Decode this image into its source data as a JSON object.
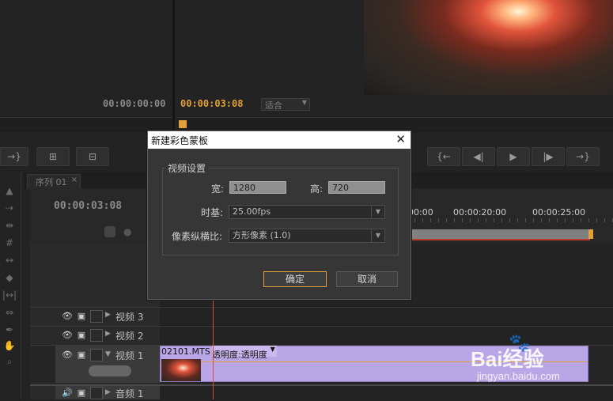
{
  "source_monitor": {
    "timecode": "00:00:00:00"
  },
  "program_monitor": {
    "timecode": "00:00:03:08",
    "zoom": "适合"
  },
  "sequence": {
    "tab": "序列 01",
    "timecode": "00:00:03:08",
    "ruler": [
      "00:00",
      "00:00:20:00",
      "00:00:25:00"
    ]
  },
  "tracks": [
    {
      "label": "视频 3"
    },
    {
      "label": "视频 2"
    },
    {
      "label": "视频 1"
    },
    {
      "label": "音频 1"
    }
  ],
  "clip": {
    "name": "02101.MTS",
    "effect": "透明度:透明度"
  },
  "dialog": {
    "title": "新建彩色蒙板",
    "group_title": "视频设置",
    "width_label": "宽:",
    "width_value": "1280",
    "height_label": "高:",
    "height_value": "720",
    "timebase_label": "时基:",
    "timebase_value": "25.00fps",
    "par_label": "像素纵横比:",
    "par_value": "方形像素 (1.0)",
    "ok_label": "确定",
    "cancel_label": "取消"
  },
  "watermark": {
    "brand": "Bai经验",
    "url": "jingyan.baidu.com"
  },
  "colors": {
    "accent": "#e2a03a",
    "clip": "#b9a6e6",
    "playhead": "#d84b3a"
  }
}
